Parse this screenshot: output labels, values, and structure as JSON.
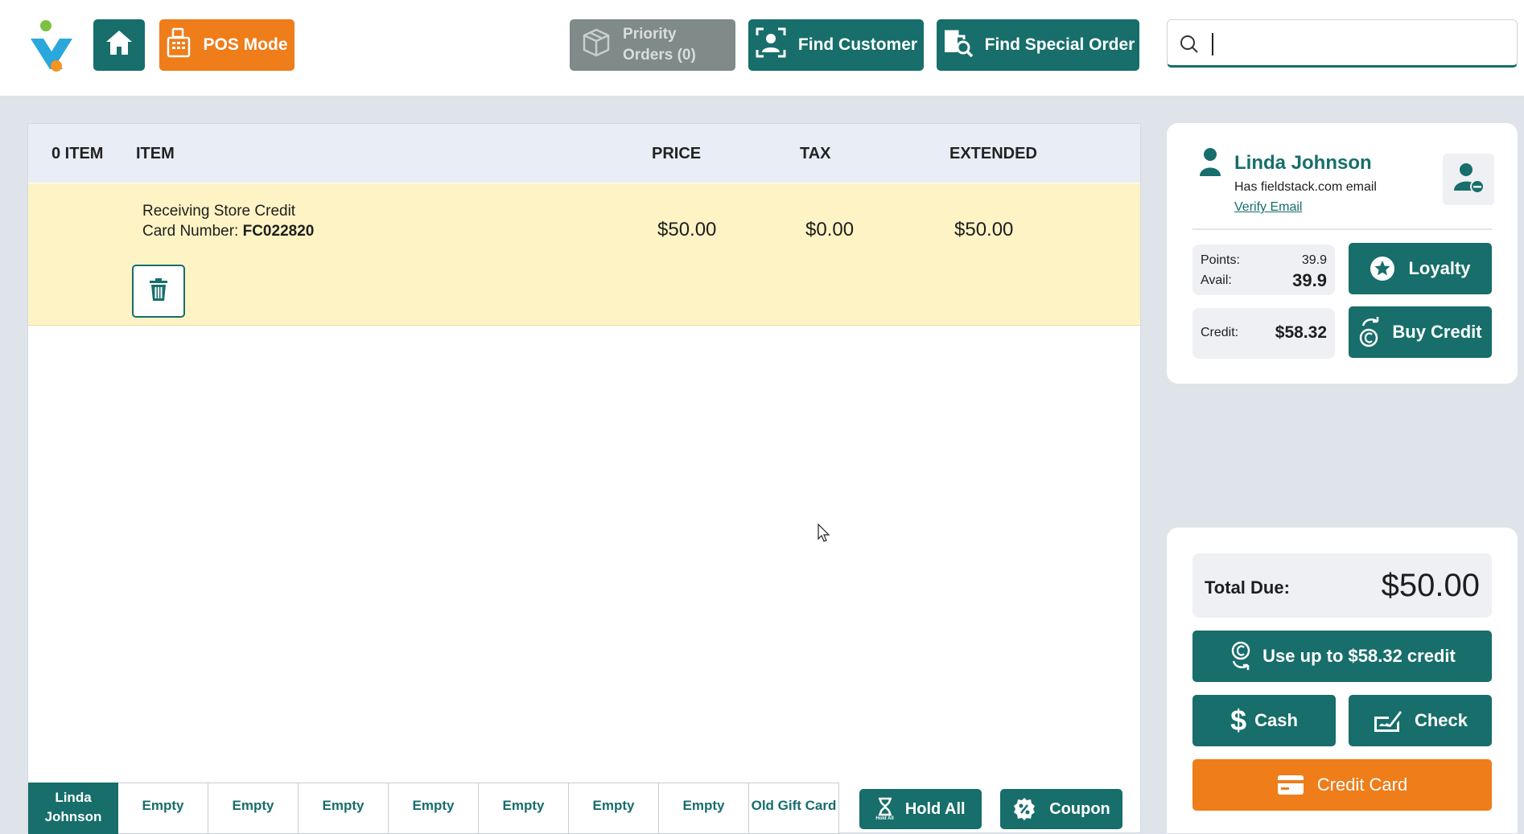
{
  "header": {
    "home_label": "Home",
    "pos_mode_label": "POS Mode",
    "priority_orders_line1": "Priority",
    "priority_orders_line2": "Orders (0)",
    "find_customer_label": "Find Customer",
    "find_special_order_label": "Find Special Order",
    "search_value": ""
  },
  "cart": {
    "columns": {
      "count": "0 ITEM",
      "item": "ITEM",
      "price": "PRICE",
      "tax": "TAX",
      "extended": "EXTENDED"
    },
    "rows": [
      {
        "line1": "Receiving Store Credit",
        "card_label": "Card Number: ",
        "card_number": "FC022820",
        "price": "$50.00",
        "tax": "$0.00",
        "extended": "$50.00"
      }
    ]
  },
  "order_tabs": [
    "Linda Johnson",
    "Empty",
    "Empty",
    "Empty",
    "Empty",
    "Empty",
    "Empty",
    "Empty",
    "Old Gift Card"
  ],
  "footer_actions": {
    "hold_all_label": "Hold All",
    "hold_all_icon_caption": "Hold All",
    "coupon_label": "Coupon"
  },
  "customer": {
    "name": "Linda Johnson",
    "email_note": "Has fieldstack.com email",
    "verify_link": "Verify Email",
    "points_label": "Points:",
    "points_value": "39.9",
    "avail_label": "Avail:",
    "avail_value": "39.9",
    "loyalty_label": "Loyalty",
    "credit_label": "Credit:",
    "credit_value": "$58.32",
    "buy_credit_label": "Buy Credit"
  },
  "payment": {
    "total_due_label": "Total Due:",
    "total_due_value": "$50.00",
    "use_credit_label": "Use up to $58.32 credit",
    "cash_label": "Cash",
    "check_label": "Check",
    "credit_card_label": "Credit Card"
  },
  "colors": {
    "teal": "#176e6b",
    "orange": "#ee7d1a",
    "grey_disabled": "#7f8a89",
    "row_highlight": "#fdf3c4",
    "background": "#dfe3ea"
  },
  "icons": [
    "logo-icon",
    "home-icon",
    "pos-terminal-icon",
    "box-icon",
    "find-customer-icon",
    "find-order-icon",
    "search-icon",
    "trash-icon",
    "user-icon",
    "remove-user-icon",
    "star-icon",
    "credit-coin-icon",
    "dollar-icon",
    "check-icon",
    "credit-card-icon",
    "hourglass-icon",
    "coupon-icon",
    "mouse-cursor-icon"
  ]
}
